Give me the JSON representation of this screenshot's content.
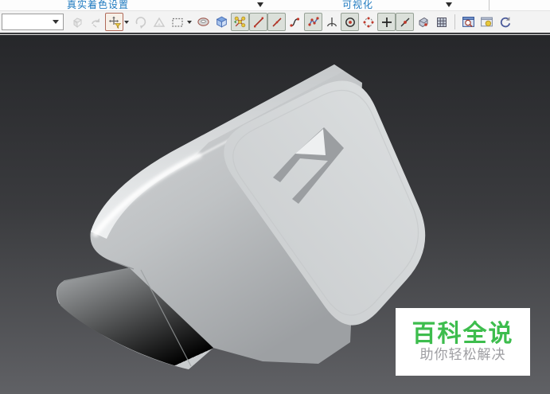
{
  "menu_strip": {
    "dropdown1_label": "真实着色设置",
    "dropdown2_label": "可视化",
    "label_color": "#1f7ac0"
  },
  "toolbar": {
    "selection_combo": {
      "value": "",
      "placeholder": ""
    },
    "buttons": [
      {
        "name": "select-and-link",
        "state": "disabled"
      },
      {
        "name": "unlink-selection",
        "state": "disabled"
      },
      {
        "name": "select-and-move",
        "state": "highlighted"
      },
      {
        "name": "select-and-rotate",
        "state": "disabled"
      },
      {
        "name": "select-and-scale",
        "state": "disabled"
      },
      {
        "name": "rectangular-selection-region",
        "state": "normal"
      },
      {
        "name": "torus",
        "state": "normal"
      },
      {
        "name": "box",
        "state": "normal"
      },
      {
        "name": "snaps-toggle",
        "state": "active"
      },
      {
        "name": "snap-edge",
        "state": "active"
      },
      {
        "name": "snap-segment",
        "state": "active"
      },
      {
        "name": "snap-curve",
        "state": "normal"
      },
      {
        "name": "snap-spline",
        "state": "active"
      },
      {
        "name": "snap-perpendicular",
        "state": "normal"
      },
      {
        "name": "snap-center",
        "state": "active"
      },
      {
        "name": "snap-circle",
        "state": "normal"
      },
      {
        "name": "snap-cross",
        "state": "active"
      },
      {
        "name": "snap-tangent",
        "state": "active"
      },
      {
        "name": "snap-face",
        "state": "normal"
      },
      {
        "name": "grid",
        "state": "normal"
      },
      {
        "name": "render-preview",
        "state": "normal"
      },
      {
        "name": "render-setup",
        "state": "normal"
      },
      {
        "name": "refresh",
        "state": "normal"
      }
    ]
  },
  "viewport": {
    "model": "white power adapter (3d shaded view)",
    "bg_top": "#26272a",
    "bg_bottom": "#606165",
    "watermark": {
      "title": "百科全说",
      "subtitle": "助你轻松解决",
      "title_color": "#3dbd4d",
      "subtitle_color": "#9e9ea2"
    }
  },
  "icons": [
    "link-icon",
    "undo-icon",
    "move-funnel-icon",
    "rotate-icon",
    "scale-icon",
    "region-icon",
    "torus-icon",
    "box-icon",
    "snaps-icon",
    "diagonal-icon",
    "curve-icon",
    "spline-icon",
    "perpendicular-icon",
    "center-circle-icon",
    "dashed-circle-icon",
    "plus-icon",
    "tangent-icon",
    "face-icon",
    "grid-icon",
    "magnifier-window-icon",
    "image-window-icon",
    "refresh-icon"
  ]
}
